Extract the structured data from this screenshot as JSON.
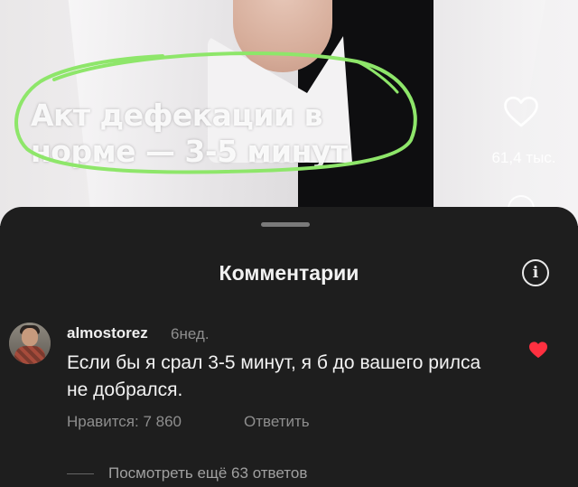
{
  "video": {
    "overlay_text": "Акт дефекации в норме — 3-5 минут",
    "like_count": "61,4 тыс.",
    "highlight_color": "#8ee66a"
  },
  "comments_sheet": {
    "title": "Комментарии"
  },
  "comment": {
    "username": "almostorez",
    "time": "6нед.",
    "text": "Если бы я срал 3-5 минут, я б до вашего рилса не добрался.",
    "likes": "Нравится: 7 860",
    "reply_label": "Ответить",
    "liked": true,
    "liked_color": "#ff3040",
    "view_replies": "Посмотреть ещё 63 ответов"
  }
}
